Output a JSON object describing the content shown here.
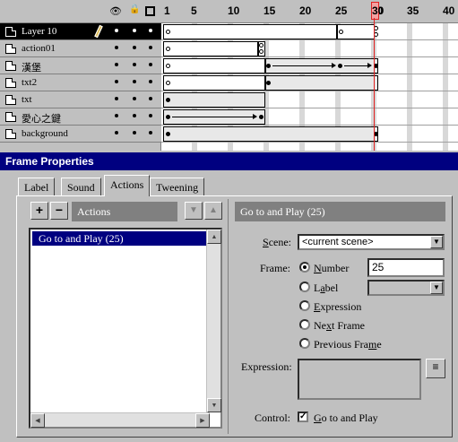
{
  "timeline": {
    "header_icons": {
      "eye": "eye-icon",
      "lock": "lock-icon",
      "outline": "outline-icon"
    },
    "ruler_labels": [
      "1",
      "5",
      "10",
      "15",
      "20",
      "25",
      "30",
      "35",
      "40"
    ],
    "current_frame": "30",
    "layers": [
      {
        "name": "Layer 10",
        "selected": true
      },
      {
        "name": "action01",
        "selected": false
      },
      {
        "name": "漢堡",
        "selected": false
      },
      {
        "name": "txt2",
        "selected": false
      },
      {
        "name": "txt",
        "selected": false
      },
      {
        "name": "愛心之鍵",
        "selected": false
      },
      {
        "name": "background",
        "selected": false
      }
    ]
  },
  "frame_properties": {
    "title": "Frame Properties",
    "tabs": [
      "Label",
      "Sound",
      "Actions",
      "Tweening"
    ],
    "active_tab": "Actions",
    "actions_header": "Actions",
    "add_button": "+",
    "remove_button": "−",
    "action_list": [
      "Go to and Play (25)"
    ],
    "detail_header": "Go to and Play (25)",
    "scene_label": "Scene:",
    "scene_value": "<current scene>",
    "frame_label": "Frame:",
    "radio_number": "Number",
    "number_value": "25",
    "radio_label": "Label",
    "radio_expression": "Expression",
    "radio_next": "Next Frame",
    "radio_previous": "Previous Frame",
    "expression_label": "Expression:",
    "control_label": "Control:",
    "control_checkbox": "Go to and Play"
  }
}
